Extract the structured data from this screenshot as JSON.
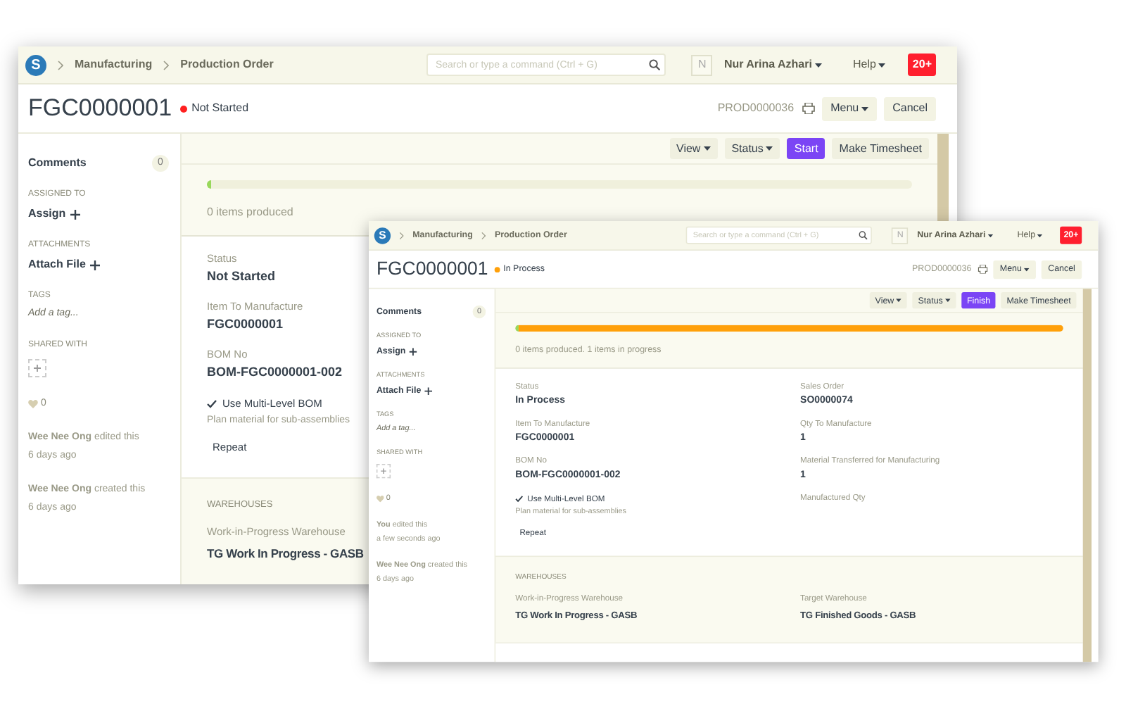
{
  "windows": [
    {
      "topbar": {
        "logo": "S",
        "breadcrumbs": [
          "Manufacturing",
          "Production Order"
        ],
        "search": {
          "placeholder": "Search or type a command (Ctrl + G)"
        },
        "avatar": "N",
        "user": "Nur Arina Azhari",
        "help": "Help",
        "notifications": "20+"
      },
      "title": "FGC0000001",
      "status": {
        "label": "Not Started",
        "color": "#ff2020"
      },
      "doc_name": "PROD0000036",
      "actions": [
        {
          "label": "Menu",
          "kind": "dropdown"
        },
        {
          "label": "Cancel",
          "kind": "plain"
        }
      ],
      "toolbar": [
        {
          "label": "View",
          "kind": "dropdown"
        },
        {
          "label": "Status",
          "kind": "dropdown"
        },
        {
          "label": "Start",
          "kind": "primary"
        },
        {
          "label": "Make Timesheet",
          "kind": "plain"
        }
      ],
      "progress": {
        "segments": [
          {
            "level": 0.006,
            "color": "#98d85b"
          }
        ],
        "caption": "0 items produced"
      },
      "sidebar": {
        "comments": {
          "label": "Comments",
          "count": "0"
        },
        "assigned_to": {
          "heading": "ASSIGNED TO",
          "action": "Assign"
        },
        "attachments": {
          "heading": "ATTACHMENTS",
          "action": "Attach File"
        },
        "tags": {
          "heading": "TAGS",
          "action": "Add a tag..."
        },
        "shared_with": {
          "heading": "SHARED WITH"
        },
        "likes": "0",
        "activity": [
          {
            "text": "**Wee Nee Ong** edited this",
            "time": "6 days ago"
          },
          {
            "text": "**Wee Nee Ong** created this",
            "time": "6 days ago"
          }
        ]
      },
      "fields": [
        [
          {
            "kind": "field",
            "label": "Status",
            "value": "Not Started"
          },
          {
            "kind": "field",
            "label": "Item To Manufacture",
            "value": "FGC0000001"
          },
          {
            "kind": "field",
            "label": "BOM No",
            "value": "BOM-FGC0000001-002"
          },
          {
            "kind": "check",
            "label": "Use Multi-Level BOM",
            "checked": true,
            "description": "Plan material for sub-assemblies"
          },
          {
            "kind": "button",
            "label": "Repeat"
          }
        ]
      ],
      "warehouses": {
        "heading": "WAREHOUSES",
        "columns": [
          [
            {
              "label": "Work-in-Progress Warehouse",
              "value": "TG Work In Progress - GASB"
            }
          ]
        ]
      }
    },
    {
      "topbar": {
        "logo": "S",
        "breadcrumbs": [
          "Manufacturing",
          "Production Order"
        ],
        "search": {
          "placeholder": "Search or type a command (Ctrl + G)"
        },
        "avatar": "N",
        "user": "Nur Arina Azhari",
        "help": "Help",
        "notifications": "20+"
      },
      "title": "FGC0000001",
      "status": {
        "label": "In Process",
        "color": "#ffa00a"
      },
      "doc_name": "PROD0000036",
      "actions": [
        {
          "label": "Menu",
          "kind": "dropdown"
        },
        {
          "label": "Cancel",
          "kind": "plain"
        }
      ],
      "toolbar": [
        {
          "label": "View",
          "kind": "dropdown"
        },
        {
          "label": "Status",
          "kind": "dropdown"
        },
        {
          "label": "Finish",
          "kind": "primary"
        },
        {
          "label": "Make Timesheet",
          "kind": "plain"
        }
      ],
      "progress": {
        "segments": [
          {
            "level": 0.006,
            "color": "#98d85b"
          },
          {
            "level": 0.994,
            "color": "#ffa00a"
          }
        ],
        "caption": "0 items produced. 1 items in progress"
      },
      "sidebar": {
        "comments": {
          "label": "Comments",
          "count": "0"
        },
        "assigned_to": {
          "heading": "ASSIGNED TO",
          "action": "Assign"
        },
        "attachments": {
          "heading": "ATTACHMENTS",
          "action": "Attach File"
        },
        "tags": {
          "heading": "TAGS",
          "action": "Add a tag..."
        },
        "shared_with": {
          "heading": "SHARED WITH"
        },
        "likes": "0",
        "activity": [
          {
            "text": "**You** edited this",
            "time": "a few seconds ago"
          },
          {
            "text": "**Wee Nee Ong** created this",
            "time": "6 days ago"
          }
        ]
      },
      "fields": [
        [
          {
            "kind": "field",
            "label": "Status",
            "value": "In Process"
          },
          {
            "kind": "field",
            "label": "Item To Manufacture",
            "value": "FGC0000001"
          },
          {
            "kind": "field",
            "label": "BOM No",
            "value": "BOM-FGC0000001-002"
          },
          {
            "kind": "check",
            "label": "Use Multi-Level BOM",
            "checked": true,
            "description": "Plan material for sub-assemblies"
          },
          {
            "kind": "button",
            "label": "Repeat"
          }
        ],
        [
          {
            "kind": "field",
            "label": "Sales Order",
            "value": "SO0000074"
          },
          {
            "kind": "field",
            "label": "Qty To Manufacture",
            "value": "1"
          },
          {
            "kind": "field",
            "label": "Material Transferred for Manufacturing",
            "value": "1"
          },
          {
            "kind": "field",
            "label": "Manufactured Qty"
          }
        ]
      ],
      "warehouses": {
        "heading": "WAREHOUSES",
        "columns": [
          [
            {
              "label": "Work-in-Progress Warehouse",
              "value": "TG Work In Progress - GASB"
            }
          ],
          [
            {
              "label": "Target Warehouse",
              "value": "TG Finished Goods - GASB"
            }
          ]
        ]
      }
    }
  ]
}
